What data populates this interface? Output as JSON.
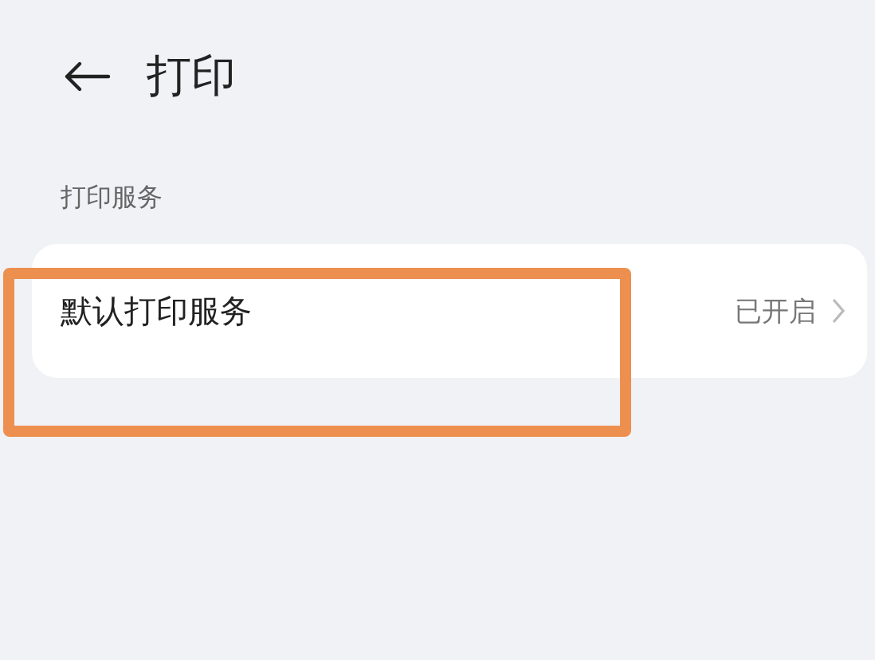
{
  "header": {
    "title": "打印"
  },
  "section": {
    "label": "打印服务"
  },
  "rows": [
    {
      "label": "默认打印服务",
      "value": "已开启"
    }
  ],
  "annotation": {
    "kind": "frame"
  }
}
